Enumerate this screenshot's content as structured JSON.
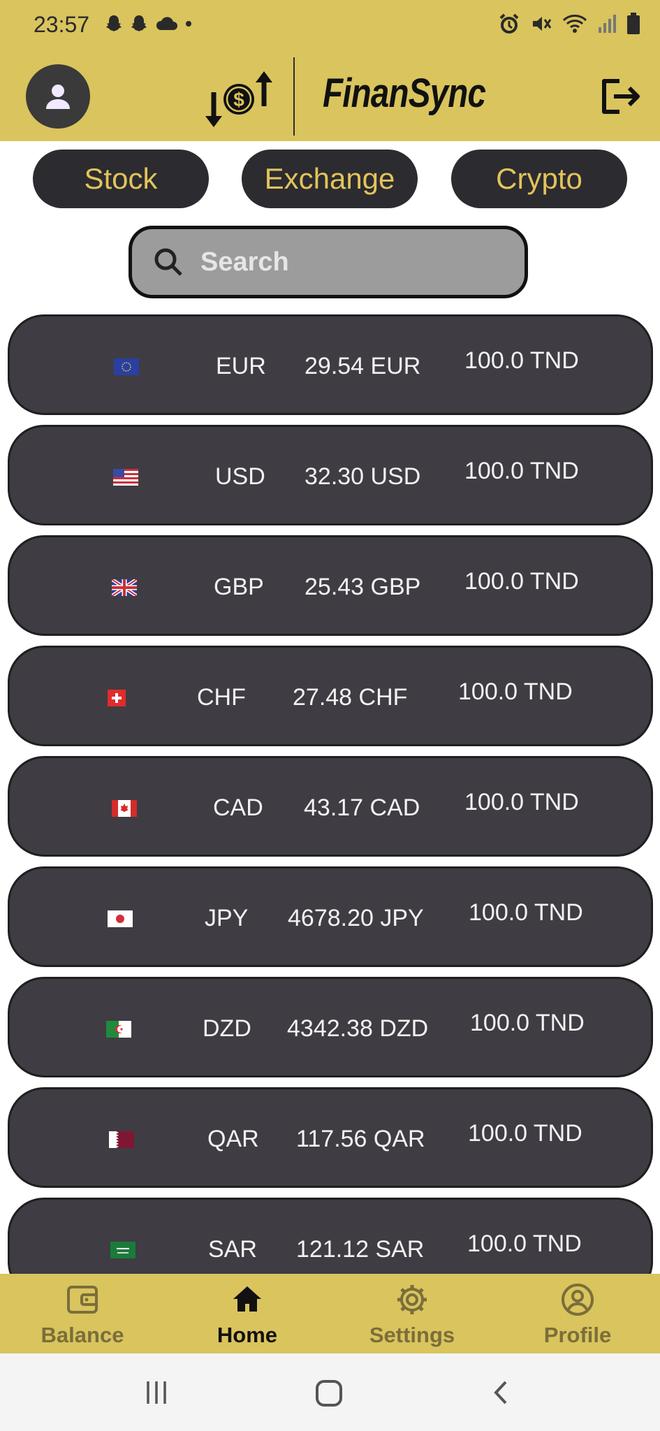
{
  "status": {
    "time": "23:57"
  },
  "header": {
    "brand": "FinanSync"
  },
  "tabs": [
    {
      "label": "Stock"
    },
    {
      "label": "Exchange"
    },
    {
      "label": "Crypto"
    }
  ],
  "search": {
    "placeholder": "Search"
  },
  "rates": [
    {
      "code": "EUR",
      "amount": "29.54 EUR",
      "base": "100.0 TND",
      "flag": "eu-flag-icon"
    },
    {
      "code": "USD",
      "amount": "32.30 USD",
      "base": "100.0 TND",
      "flag": "us-flag-icon"
    },
    {
      "code": "GBP",
      "amount": "25.43 GBP",
      "base": "100.0 TND",
      "flag": "uk-flag-icon"
    },
    {
      "code": "CHF",
      "amount": "27.48 CHF",
      "base": "100.0 TND",
      "flag": "ch-flag-icon"
    },
    {
      "code": "CAD",
      "amount": "43.17 CAD",
      "base": "100.0 TND",
      "flag": "ca-flag-icon"
    },
    {
      "code": "JPY",
      "amount": "4678.20 JPY",
      "base": "100.0 TND",
      "flag": "jp-flag-icon"
    },
    {
      "code": "DZD",
      "amount": "4342.38 DZD",
      "base": "100.0 TND",
      "flag": "dz-flag-icon"
    },
    {
      "code": "QAR",
      "amount": "117.56 QAR",
      "base": "100.0 TND",
      "flag": "qa-flag-icon"
    },
    {
      "code": "SAR",
      "amount": "121.12 SAR",
      "base": "100.0 TND",
      "flag": "sa-flag-icon"
    }
  ],
  "bottom_nav": [
    {
      "label": "Balance",
      "icon": "wallet-icon"
    },
    {
      "label": "Home",
      "icon": "home-icon",
      "active": true
    },
    {
      "label": "Settings",
      "icon": "gear-icon"
    },
    {
      "label": "Profile",
      "icon": "profile-icon"
    }
  ],
  "colors": {
    "accent": "#d9c45e",
    "pill_bg": "#2c2b30",
    "pill_text": "#e2c45a",
    "row_bg": "#3f3c43"
  }
}
